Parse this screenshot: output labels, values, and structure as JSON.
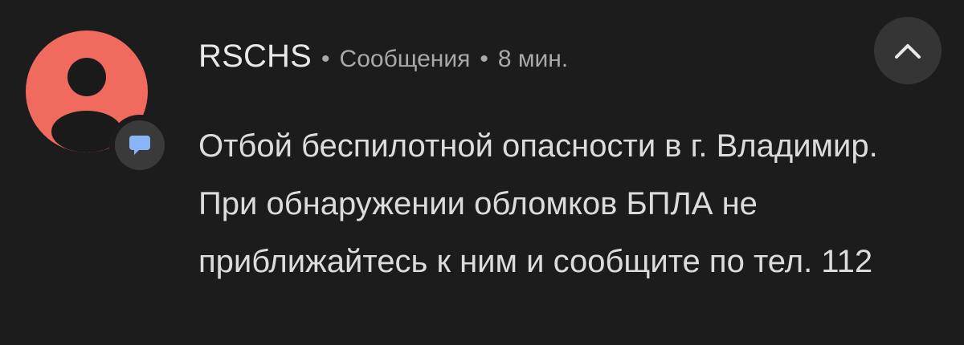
{
  "notification": {
    "sender": "RSCHS",
    "separator_1": "•",
    "category": "Сообщения",
    "separator_2": "•",
    "time_ago": "8 мин.",
    "message": "Отбой беспилотной опасности в г. Владимир. При обнаружении обломков БПЛА не приближайтесь к ним и сообщите по тел. 112",
    "avatar_icon": "person-icon",
    "app_badge_icon": "chat-bubble-icon",
    "collapse_icon": "chevron-up-icon"
  },
  "colors": {
    "background": "#1c1c1c",
    "avatar": "#f06a5e",
    "badge": "#3a3a3a",
    "badge_icon": "#8ab4f8",
    "collapse_button": "#353535",
    "primary_text": "#e8e8e8",
    "secondary_text": "#a9a9a9"
  }
}
